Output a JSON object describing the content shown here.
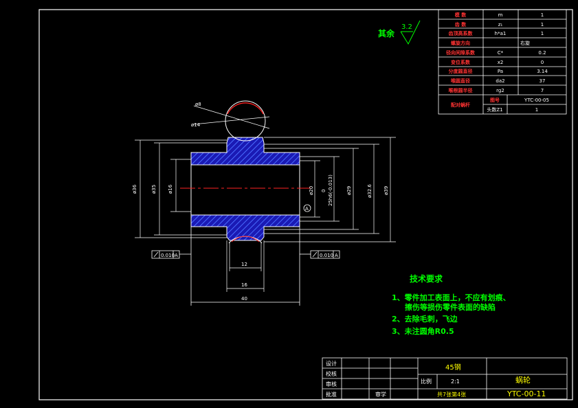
{
  "colors": {
    "background": "#000000",
    "line": "#ffffff",
    "section_fill": "#1a1ab4",
    "hatch": "#4a6cff",
    "centerline": "#ff2222",
    "tech_text": "#00ff00",
    "title_text": "#ffff00"
  },
  "roughness": {
    "label": "其余",
    "value": "3.2"
  },
  "param_table": [
    {
      "name": "模 数",
      "symbol": "m",
      "value": "1"
    },
    {
      "name": "齿 数",
      "symbol": "z₁",
      "value": "1"
    },
    {
      "name": "齿顶高系数",
      "symbol": "h*a1",
      "value": "1"
    },
    {
      "name": "螺旋方向",
      "symbol": "",
      "value": "右旋"
    },
    {
      "name": "径向间隙系数",
      "symbol": "C*",
      "value": "0.2"
    },
    {
      "name": "变位系数",
      "symbol": "x2",
      "value": "0"
    },
    {
      "name": "分度圆直径",
      "symbol": "Pa",
      "value": "3.14"
    },
    {
      "name": "喉圆直径",
      "symbol": "da2",
      "value": "37"
    },
    {
      "name": "喉根圆半径",
      "symbol": "rg2",
      "value": "7"
    }
  ],
  "mating": {
    "label": "配对蜗杆",
    "row1_key": "图号",
    "row1_val": "YTC-00-05",
    "row2_key": "头数Z1",
    "row2_val": "1"
  },
  "dims": {
    "d_r8": "ø8",
    "d_14": "ø14",
    "d_36": "ø36",
    "d_35": "ø35",
    "d_16": "ø16",
    "d_20": "ø20",
    "fit": "25h6(-0.013)",
    "fit_upper": "0",
    "d_29": "ø29",
    "d_32_6": "ø32.6",
    "d_39": "ø39",
    "len_12": "12",
    "len_16": "16",
    "len_40": "40",
    "datum": "A",
    "tol_left_val": "0.010",
    "tol_right_val": "0.010",
    "tol_datum": "A"
  },
  "tech": {
    "title": "技术要求",
    "items": [
      "1、零件加工表面上，不应有划痕、",
      "擦伤等损伤零件表面的缺陷",
      "2、去除毛刺，飞边",
      "3、未注圆角R0.5"
    ]
  },
  "title_block": {
    "design": "设计",
    "check": "校核",
    "review": "审核",
    "approve": "批准",
    "material": "45钢",
    "scale_label": "比例",
    "scale": "2:1",
    "sheets": "共7张第4张",
    "part_name": "蜗轮",
    "drawing_no": "YTC-00-11",
    "stage": "审学"
  }
}
